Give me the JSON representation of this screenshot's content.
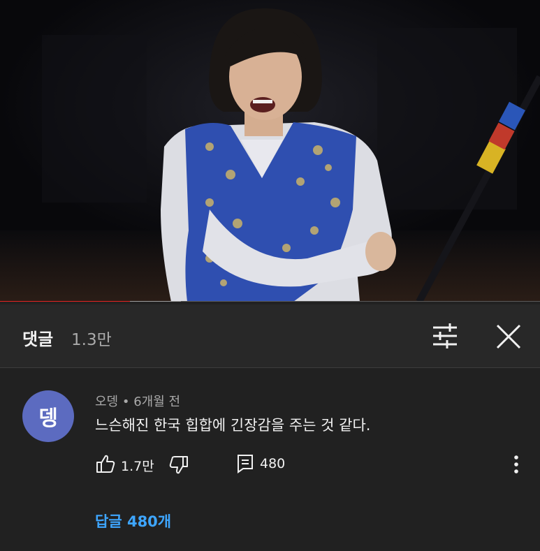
{
  "comments_header": {
    "title": "댓글",
    "count": "1.3만"
  },
  "video": {
    "progress": 0.24,
    "buffered": 0.335
  },
  "comment": {
    "avatar_letter": "뎅",
    "avatar_color": "#5c6bc0",
    "author": "오뎅",
    "time": "6개월 전",
    "text": "느슨해진 한국 힙합에 긴장감을 주는 것 같다.",
    "likes": "1.7만",
    "reply_count": "480",
    "replies_link": "답글 480개"
  },
  "icons": {
    "filter": "sliders-icon",
    "close": "close-icon",
    "like": "thumbs-up-icon",
    "dislike": "thumbs-down-icon",
    "reply": "reply-icon",
    "more": "more-vert-icon"
  },
  "colors": {
    "accent_red": "#e52221",
    "link_blue": "#3ea6ff",
    "background": "#212121"
  }
}
